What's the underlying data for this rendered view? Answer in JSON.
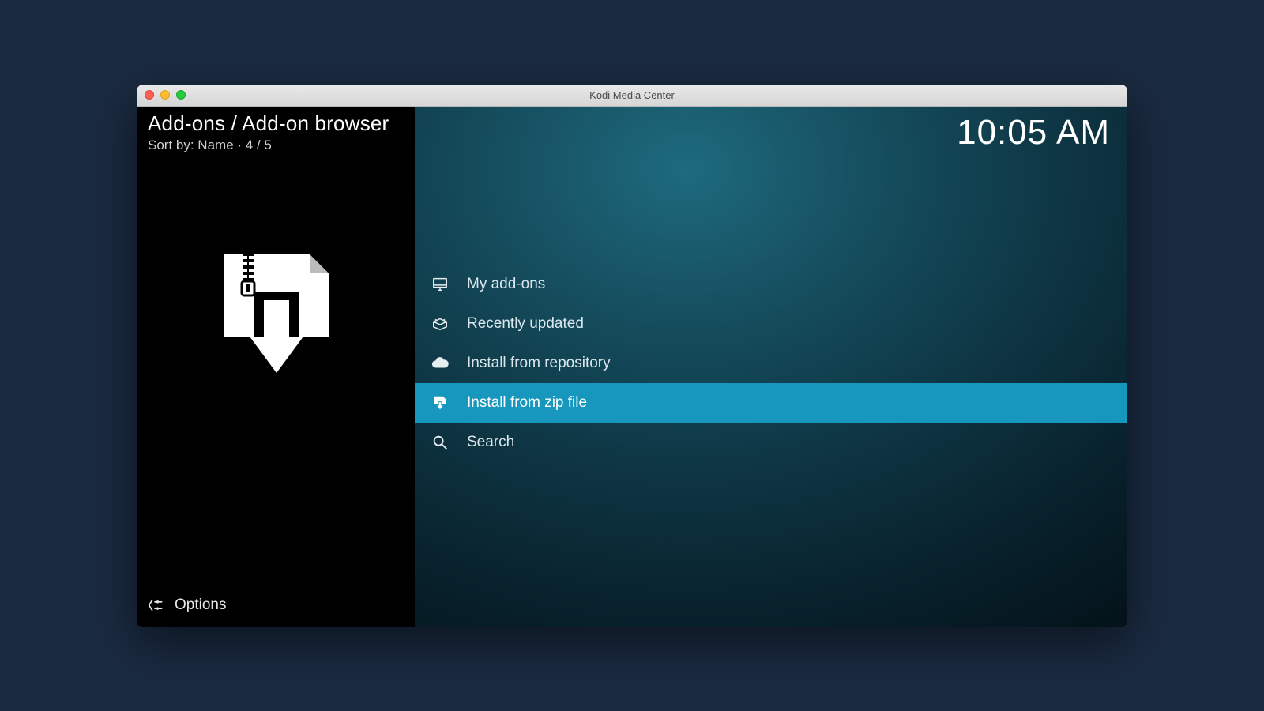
{
  "window": {
    "title": "Kodi Media Center"
  },
  "sidebar": {
    "breadcrumb": "Add-ons / Add-on browser",
    "sort_line": "Sort by: Name  · 4 / 5",
    "options_label": "Options"
  },
  "clock": "10:05 AM",
  "menu": {
    "items": [
      {
        "label": "My add-ons",
        "icon": "monitor-icon",
        "selected": false
      },
      {
        "label": "Recently updated",
        "icon": "box-open-icon",
        "selected": false
      },
      {
        "label": "Install from repository",
        "icon": "cloud-download-icon",
        "selected": false
      },
      {
        "label": "Install from zip file",
        "icon": "zip-download-icon",
        "selected": true
      },
      {
        "label": "Search",
        "icon": "search-icon",
        "selected": false
      }
    ]
  }
}
